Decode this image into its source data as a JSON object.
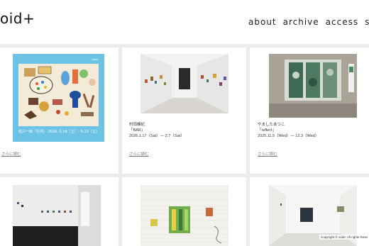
{
  "header": {
    "logo": "oid+",
    "nav": [
      "about",
      "archive",
      "access",
      "sho"
    ]
  },
  "poster": {
    "brand": "void+",
    "title_line": "佐川一郎「行列」 2026. 5.16（土）– 6.13（土）"
  },
  "cards": [
    {
      "artist": "",
      "title": "",
      "dates": "",
      "more": "さらに読む"
    },
    {
      "artist": "村田峰紀",
      "title": "「BAR」",
      "dates": "2026.1.17（Sat）— 2.7（Sat）",
      "more": "さらに読む"
    },
    {
      "artist": "やましたあつこ",
      "title": "「reflect」",
      "dates": "2025.11.5（Wed）— 12.3（Wed）",
      "more": "さらに読む"
    }
  ],
  "footer": {
    "copyright": "Copyright © void+ All rights Rese"
  },
  "colors": {
    "grid_background": "#ececec",
    "poster_blue": "#6cc3e6",
    "poster_inner": "#f3ead8"
  }
}
